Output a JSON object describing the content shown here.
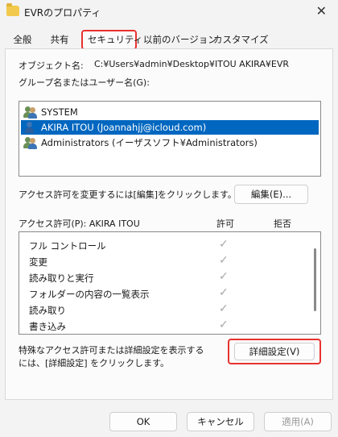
{
  "window": {
    "title": "EVRのプロパティ",
    "close_glyph": "✕"
  },
  "tabs": [
    {
      "label": "全般"
    },
    {
      "label": "共有"
    },
    {
      "label": "セキュリティ"
    },
    {
      "label": "以前のバージョン"
    },
    {
      "label": "カスタマイズ"
    }
  ],
  "security": {
    "object_name_label": "オブジェクト名:",
    "object_name_value": "C:¥Users¥admin¥Desktop¥ITOU AKIRA¥EVR",
    "group_label": "グループ名またはユーザー名(G):",
    "principals": [
      {
        "name": "SYSTEM",
        "icon": "group-users-icon"
      },
      {
        "name": "AKIRA ITOU (Joannahjj@icloud.com)",
        "icon": "user-icon"
      },
      {
        "name": "Administrators (イーザスソフト¥Administrators)",
        "icon": "group-users-icon"
      }
    ],
    "change_hint": "アクセス許可を変更するには[編集]をクリックします。",
    "edit_button": "編集(E)...",
    "permissions_header": "アクセス許可(P): AKIRA ITOU",
    "allow_header": "許可",
    "deny_header": "拒否",
    "permissions": [
      {
        "name": "フル コントロール",
        "allow": "✓"
      },
      {
        "name": "変更",
        "allow": "✓"
      },
      {
        "name": "読み取りと実行",
        "allow": "✓"
      },
      {
        "name": "フォルダーの内容の一覧表示",
        "allow": "✓"
      },
      {
        "name": "読み取り",
        "allow": "✓"
      },
      {
        "name": "書き込み",
        "allow": "✓"
      }
    ],
    "advanced_hint_line1": "特殊なアクセス許可または詳細設定を表示する",
    "advanced_hint_line2": "には、[詳細設定] をクリックします。",
    "advanced_button": "詳細設定(V)"
  },
  "footer": {
    "ok": "OK",
    "cancel": "キャンセル",
    "apply": "適用(A)"
  },
  "colors": {
    "highlight": "#0067c0",
    "annotation": "#e8322f"
  }
}
